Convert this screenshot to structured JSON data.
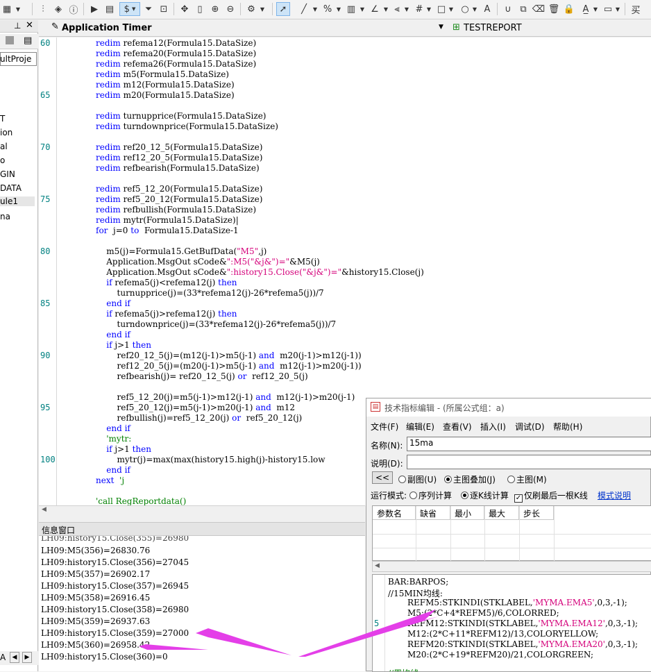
{
  "toolbar": {
    "dollar_label": "$"
  },
  "left_panel": {
    "project_label": "ultProje",
    "tree_items": [
      "T",
      "ion",
      "al",
      "o",
      "GIN",
      "DATA",
      "ule1",
      "na"
    ],
    "bottom_label": "A"
  },
  "editor": {
    "tab_title": "Application Timer",
    "report_title": "TESTREPORT",
    "line_numbers": [
      "60",
      "65",
      "70",
      "75",
      "80",
      "85",
      "90",
      "95",
      "100"
    ]
  },
  "info": {
    "title": "信息窗口",
    "lines": [
      "LH09:M5(356)=26830.76",
      "LH09:history15.Close(356)=27045",
      "LH09:M5(357)=26902.17",
      "LH09:history15.Close(357)=26945",
      "LH09:M5(358)=26916.45",
      "LH09:history15.Close(358)=26980",
      "LH09:M5(359)=26937.63",
      "LH09:history15.Close(359)=27000",
      "LH09:M5(360)=26958.42",
      "LH09:history15.Close(360)=0"
    ]
  },
  "dialog": {
    "title": "技术指标编辑 - (所属公式组：a)",
    "menu": [
      "文件(F)",
      "编辑(E)",
      "查看(V)",
      "插入(I)",
      "调试(D)",
      "帮助(H)"
    ],
    "name_label": "名称(N):",
    "name_value": "15ma",
    "desc_label": "说明(D):",
    "back_button": "<<",
    "radio_sub": "副图(U)",
    "radio_overlay": "主图叠加(J)",
    "radio_main": "主图(M)",
    "mode_label": "运行模式:",
    "mode_seq": "序列计算",
    "mode_line": "逐K线计算",
    "last_only": "仅刷最后一根K线",
    "mode_help": "模式说明",
    "grid_headers": [
      "参数名",
      "缺省",
      "最小",
      "最大",
      "步长"
    ],
    "formula_line_number": "5",
    "formula_comment": "//15MIN均线:"
  }
}
